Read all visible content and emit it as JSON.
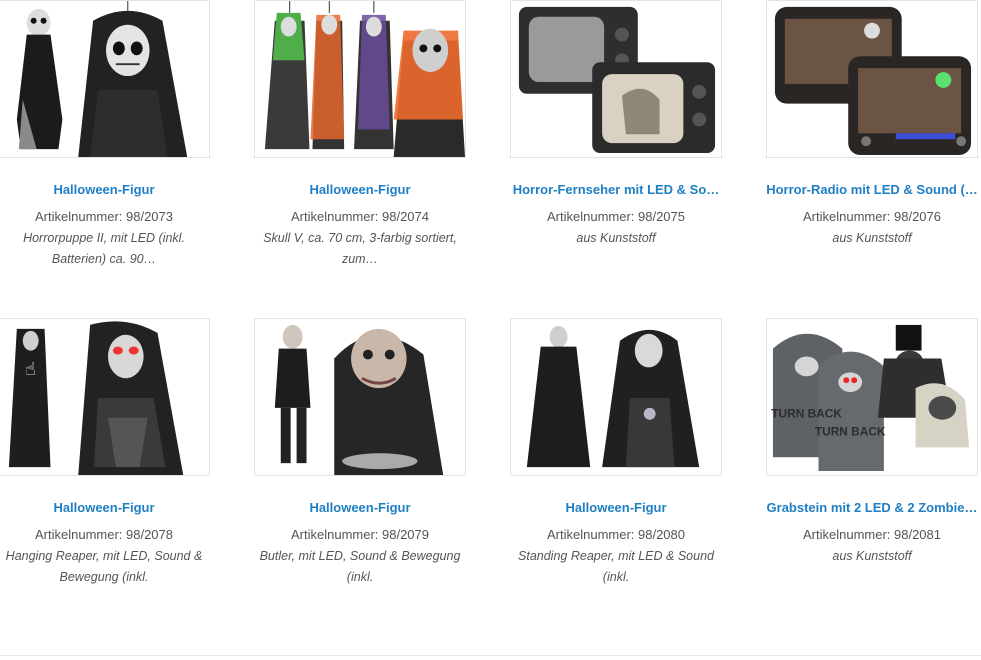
{
  "products": [
    {
      "title": "Halloween-Figur",
      "sku": "Artikelnummer: 98/2073",
      "desc_line1": "Horrorpuppe II, mit LED (inkl.",
      "desc_line2": "Batterien) ca. 90…",
      "image": "hooded-doll-figure"
    },
    {
      "title": "Halloween-Figur",
      "sku": "Artikelnummer: 98/2074",
      "desc_line1": "Skull V, ca. 70 cm, 3-farbig sortiert,",
      "desc_line2": "zum…",
      "image": "three-colored-skull-figures"
    },
    {
      "title": "Horror-Fernseher mit LED & So…",
      "sku": "Artikelnummer: 98/2075",
      "desc_line1": "aus Kunststoff",
      "desc_line2": "",
      "image": "horror-tv"
    },
    {
      "title": "Horror-Radio mit LED & Sound (…",
      "sku": "Artikelnummer: 98/2076",
      "desc_line1": "aus Kunststoff",
      "desc_line2": "",
      "image": "horror-radio"
    },
    {
      "title": "Halloween-Figur",
      "sku": "Artikelnummer: 98/2078",
      "desc_line1": "Hanging Reaper, mit LED, Sound &",
      "desc_line2": "Bewegung (inkl.",
      "image": "hanging-reaper"
    },
    {
      "title": "Halloween-Figur",
      "sku": "Artikelnummer: 98/2079",
      "desc_line1": "Butler, mit LED, Sound & Bewegung",
      "desc_line2": "(inkl.",
      "image": "butler-figure"
    },
    {
      "title": "Halloween-Figur",
      "sku": "Artikelnummer: 98/2080",
      "desc_line1": "Standing Reaper, mit LED & Sound",
      "desc_line2": "(inkl.",
      "image": "standing-reaper"
    },
    {
      "title": "Grabstein mit 2 LED & 2 Zombie…",
      "sku": "Artikelnummer: 98/2081",
      "desc_line1": "aus Kunststoff",
      "desc_line2": "",
      "image": "tombstones-zombies"
    }
  ],
  "tombstone_text": "TURN BACK",
  "colors": {
    "link": "#1f7fc4",
    "text": "#555555",
    "border": "#e3e3e3"
  }
}
